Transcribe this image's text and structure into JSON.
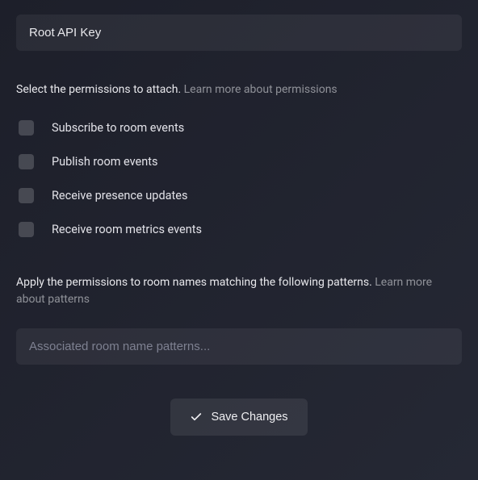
{
  "key_name_input": {
    "value": "Root API Key",
    "placeholder": ""
  },
  "permissions": {
    "helper_text": "Select the permissions to attach. ",
    "learn_more_label": "Learn more about permissions",
    "items": [
      {
        "label": "Subscribe to room events",
        "checked": false
      },
      {
        "label": "Publish room events",
        "checked": false
      },
      {
        "label": "Receive presence updates",
        "checked": false
      },
      {
        "label": "Receive room metrics events",
        "checked": false
      }
    ]
  },
  "patterns": {
    "helper_text": "Apply the permissions to room names matching the following patterns. ",
    "learn_more_label": "Learn more about patterns",
    "input_placeholder": "Associated room name patterns..."
  },
  "save_button_label": "Save Changes"
}
